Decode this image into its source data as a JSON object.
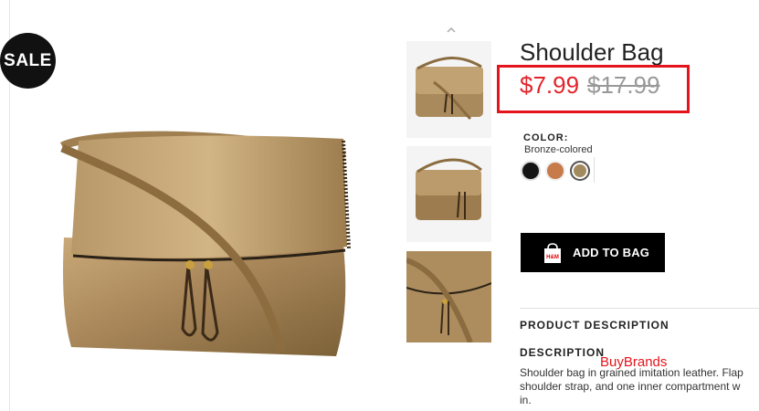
{
  "badge": {
    "sale": "SALE"
  },
  "product": {
    "title": "Shoulder Bag",
    "price_sale": "$7.99",
    "price_original": "$17.99",
    "color_label": "COLOR:",
    "color_value": "Bronze-colored",
    "swatches": [
      {
        "name": "black",
        "hex": "#141414"
      },
      {
        "name": "copper",
        "hex": "#c77a4a"
      },
      {
        "name": "bronze",
        "hex": "#a28a5e"
      }
    ],
    "add_to_bag": "ADD TO BAG",
    "bag_icon_text": "H&M"
  },
  "description": {
    "section_heading": "PRODUCT DESCRIPTION",
    "heading": "DESCRIPTION",
    "lines": [
      "Shoulder bag in grained imitation leather. Flap",
      "shoulder strap, and one inner compartment w",
      "in."
    ]
  },
  "watermark": "BuyBrands",
  "colors": {
    "sale_red": "#e3232b",
    "highlight_box": "#e5141b",
    "button": "#000000"
  }
}
